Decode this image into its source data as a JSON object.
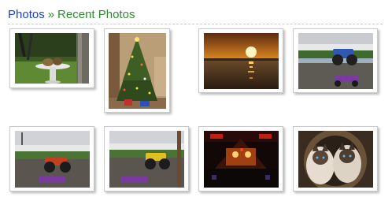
{
  "breadcrumb": {
    "root": "Photos",
    "separator": "»",
    "current": "Recent Photos"
  },
  "colors": {
    "link": "#1a3fd6",
    "current": "#2f8a2f"
  },
  "photos": [
    {
      "subject": "bird-bath-garden"
    },
    {
      "subject": "christmas-tree"
    },
    {
      "subject": "sunset-over-lake"
    },
    {
      "subject": "monster-truck-jump"
    },
    {
      "subject": "monster-truck-crash"
    },
    {
      "subject": "monster-truck-yellow"
    },
    {
      "subject": "concert-stage-lights"
    },
    {
      "subject": "siamese-cats"
    }
  ]
}
